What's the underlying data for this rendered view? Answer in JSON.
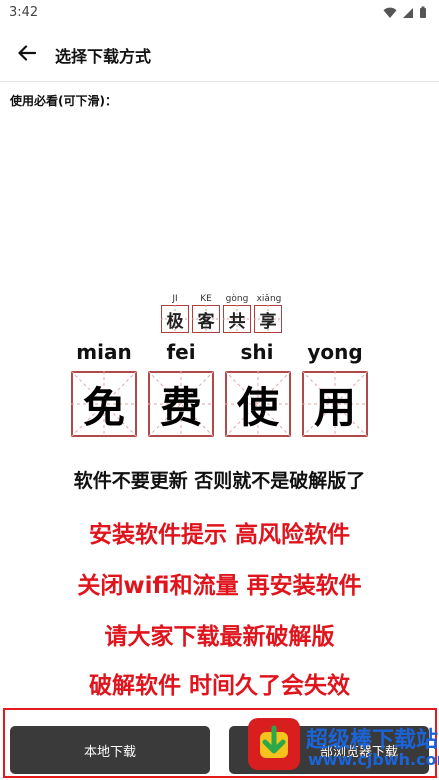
{
  "status_bar": {
    "time": "3:42"
  },
  "app_bar": {
    "title": "选择下载方式"
  },
  "notice": {
    "label": "使用必看(可下滑)："
  },
  "banner": {
    "small_chars": [
      {
        "pinyin": "JI",
        "char": "极"
      },
      {
        "pinyin": "KE",
        "char": "客"
      },
      {
        "pinyin": "gòng",
        "char": "共"
      },
      {
        "pinyin": "xiǎng",
        "char": "享"
      }
    ],
    "big_chars": [
      {
        "pinyin": "mian",
        "char": "免"
      },
      {
        "pinyin": "fei",
        "char": "费"
      },
      {
        "pinyin": "shi",
        "char": "使"
      },
      {
        "pinyin": "yong",
        "char": "用"
      }
    ],
    "line_black": "软件不要更新 否则就不是破解版了",
    "lines_red": [
      "安装软件提示 高风险软件",
      "关闭wifi和流量 再安装软件",
      "请大家下载最新破解版",
      "破解软件 时间久了会失效"
    ],
    "red_color": "#e0141c"
  },
  "buttons": {
    "local_download": "本地下载",
    "other_download": "部浏览器下载"
  },
  "watermark": {
    "title": "超级棒下载站",
    "url": "www.cjbwh.com"
  }
}
